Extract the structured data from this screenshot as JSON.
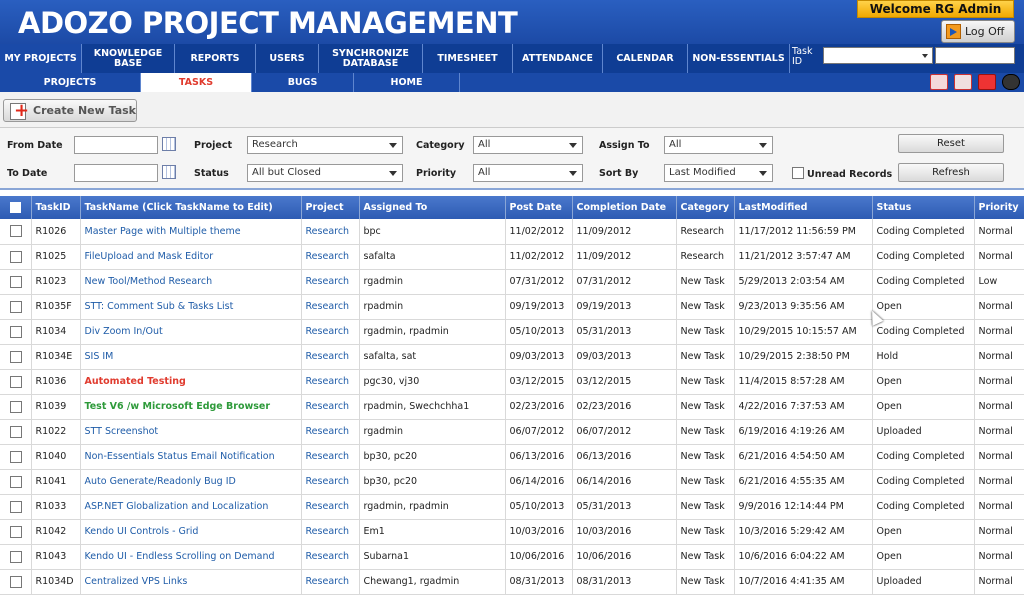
{
  "app": {
    "title": "ADOZO PROJECT MANAGEMENT",
    "welcome": "Welcome RG Admin",
    "logoff_label": "Log Off"
  },
  "main_nav": [
    {
      "label": "MY PROJECTS",
      "w": 0
    },
    {
      "label": "KNOWLEDGE BASE"
    },
    {
      "label": "REPORTS"
    },
    {
      "label": "USERS"
    },
    {
      "label": "SYNCHRONIZE DATABASE"
    },
    {
      "label": "TIMESHEET"
    },
    {
      "label": "ATTENDANCE"
    },
    {
      "label": "CALENDAR"
    },
    {
      "label": "NON-ESSENTIALS"
    }
  ],
  "taskid_label": "Task ID",
  "sub_nav": [
    "PROJECTS",
    "TASKS",
    "BUGS",
    "HOME"
  ],
  "sub_nav_active": "TASKS",
  "create_task_label": "Create New Task",
  "filters": {
    "from_date_label": "From Date",
    "to_date_label": "To Date",
    "project_label": "Project",
    "project_value": "Research",
    "status_label": "Status",
    "status_value": "All but Closed",
    "category_label": "Category",
    "category_value": "All",
    "priority_label": "Priority",
    "priority_value": "All",
    "assign_to_label": "Assign To",
    "assign_to_value": "All",
    "sort_by_label": "Sort By",
    "sort_by_value": "Last Modified",
    "unread_label": "Unread Records",
    "reset_label": "Reset",
    "refresh_label": "Refresh"
  },
  "table": {
    "headers": [
      "TaskID",
      "TaskName (Click TaskName to Edit)",
      "Project",
      "Assigned To",
      "Post Date",
      "Completion Date",
      "Category",
      "LastModified",
      "Status",
      "Priority"
    ],
    "rows": [
      {
        "id": "R1026",
        "name": "Master Page with Multiple theme",
        "project": "Research",
        "assigned": "bpc",
        "post": "11/02/2012",
        "completion": "11/09/2012",
        "category": "Research",
        "modified": "11/17/2012 11:56:59 PM",
        "status": "Coding Completed",
        "priority": "Normal",
        "style": ""
      },
      {
        "id": "R1025",
        "name": "FileUpload and Mask Editor",
        "project": "Research",
        "assigned": "safalta",
        "post": "11/02/2012",
        "completion": "11/09/2012",
        "category": "Research",
        "modified": "11/21/2012 3:57:47 AM",
        "status": "Coding Completed",
        "priority": "Normal",
        "style": ""
      },
      {
        "id": "R1023",
        "name": "New Tool/Method Research",
        "project": "Research",
        "assigned": "rgadmin",
        "post": "07/31/2012",
        "completion": "07/31/2012",
        "category": "New Task",
        "modified": "5/29/2013 2:03:54 AM",
        "status": "Coding Completed",
        "priority": "Low",
        "style": ""
      },
      {
        "id": "R1035F",
        "name": "STT: Comment Sub & Tasks List",
        "project": "Research",
        "assigned": "rpadmin",
        "post": "09/19/2013",
        "completion": "09/19/2013",
        "category": "New Task",
        "modified": "9/23/2013 9:35:56 AM",
        "status": "Open",
        "priority": "Normal",
        "style": ""
      },
      {
        "id": "R1034",
        "name": "Div Zoom In/Out",
        "project": "Research",
        "assigned": "rgadmin, rpadmin",
        "post": "05/10/2013",
        "completion": "05/31/2013",
        "category": "New Task",
        "modified": "10/29/2015 10:15:57 AM",
        "status": "Coding Completed",
        "priority": "Normal",
        "style": ""
      },
      {
        "id": "R1034E",
        "name": "SIS IM",
        "project": "Research",
        "assigned": "safalta, sat",
        "post": "09/03/2013",
        "completion": "09/03/2013",
        "category": "New Task",
        "modified": "10/29/2015 2:38:50 PM",
        "status": "Hold",
        "priority": "Normal",
        "style": ""
      },
      {
        "id": "R1036",
        "name": "Automated Testing",
        "project": "Research",
        "assigned": "pgc30, vj30",
        "post": "03/12/2015",
        "completion": "03/12/2015",
        "category": "New Task",
        "modified": "11/4/2015 8:57:28 AM",
        "status": "Open",
        "priority": "Normal",
        "style": "red"
      },
      {
        "id": "R1039",
        "name": "Test V6 /w Microsoft Edge Browser",
        "project": "Research",
        "assigned": "rpadmin, Swechchha1",
        "post": "02/23/2016",
        "completion": "02/23/2016",
        "category": "New Task",
        "modified": "4/22/2016 7:37:53 AM",
        "status": "Open",
        "priority": "Normal",
        "style": "green"
      },
      {
        "id": "R1022",
        "name": "STT Screenshot",
        "project": "Research",
        "assigned": "rgadmin",
        "post": "06/07/2012",
        "completion": "06/07/2012",
        "category": "New Task",
        "modified": "6/19/2016 4:19:26 AM",
        "status": "Uploaded",
        "priority": "Normal",
        "style": ""
      },
      {
        "id": "R1040",
        "name": "Non-Essentials Status Email Notification",
        "project": "Research",
        "assigned": "bp30, pc20",
        "post": "06/13/2016",
        "completion": "06/13/2016",
        "category": "New Task",
        "modified": "6/21/2016 4:54:50 AM",
        "status": "Coding Completed",
        "priority": "Normal",
        "style": ""
      },
      {
        "id": "R1041",
        "name": "Auto Generate/Readonly Bug ID",
        "project": "Research",
        "assigned": "bp30, pc20",
        "post": "06/14/2016",
        "completion": "06/14/2016",
        "category": "New Task",
        "modified": "6/21/2016 4:55:35 AM",
        "status": "Coding Completed",
        "priority": "Normal",
        "style": ""
      },
      {
        "id": "R1033",
        "name": "ASP.NET Globalization and Localization",
        "project": "Research",
        "assigned": "rgadmin, rpadmin",
        "post": "05/10/2013",
        "completion": "05/31/2013",
        "category": "New Task",
        "modified": "9/9/2016 12:14:44 PM",
        "status": "Coding Completed",
        "priority": "Normal",
        "style": ""
      },
      {
        "id": "R1042",
        "name": "Kendo UI Controls - Grid",
        "project": "Research",
        "assigned": "Em1",
        "post": "10/03/2016",
        "completion": "10/03/2016",
        "category": "New Task",
        "modified": "10/3/2016 5:29:42 AM",
        "status": "Open",
        "priority": "Normal",
        "style": ""
      },
      {
        "id": "R1043",
        "name": "Kendo UI - Endless Scrolling on Demand",
        "project": "Research",
        "assigned": "Subarna1",
        "post": "10/06/2016",
        "completion": "10/06/2016",
        "category": "New Task",
        "modified": "10/6/2016 6:04:22 AM",
        "status": "Open",
        "priority": "Normal",
        "style": ""
      },
      {
        "id": "R1034D",
        "name": "Centralized VPS Links",
        "project": "Research",
        "assigned": "Chewang1, rgadmin",
        "post": "08/31/2013",
        "completion": "08/31/2013",
        "category": "New Task",
        "modified": "10/7/2016 4:41:35 AM",
        "status": "Uploaded",
        "priority": "Normal",
        "style": ""
      }
    ]
  }
}
